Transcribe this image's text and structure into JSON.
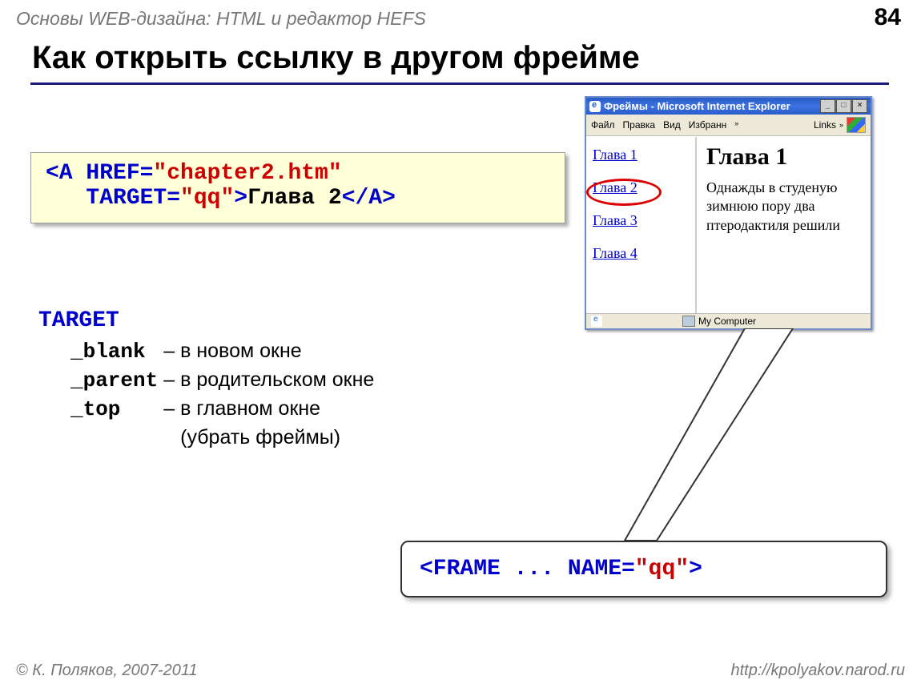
{
  "header": {
    "topic": "Основы WEB-дизайна: HTML и редактор HEFS",
    "page_number": "84"
  },
  "title": "Как открыть ссылку в другом фрейме",
  "code_example": {
    "l1_open": "<A HREF=",
    "l1_href": "\"chapter2.htm\"",
    "l2_indent_target": "TARGET=",
    "l2_qq": "\"qq\"",
    "l2_gt": ">",
    "l2_text": "Глава 2",
    "l2_close": "</A>"
  },
  "target": {
    "heading": "TARGET",
    "rows": [
      {
        "kw": "_blank",
        "dash": "–",
        "desc": "в новом окне"
      },
      {
        "kw": "_parent",
        "dash": "–",
        "desc": "в родительском окне"
      },
      {
        "kw": "_top",
        "dash": "–",
        "desc": "в главном окне"
      }
    ],
    "extra": "(убрать фреймы)"
  },
  "browser": {
    "title": "Фреймы - Microsoft Internet Explorer",
    "menu": [
      "Файл",
      "Правка",
      "Вид",
      "Избранн"
    ],
    "links_label": "Links",
    "chapters": [
      "Глава 1",
      "Глава 2",
      "Глава 3",
      "Глава 4"
    ],
    "content_heading": "Глава 1",
    "content_text": "Однажды в студеную зимнюю пору два птеродактиля решили",
    "status_right": "My Computer"
  },
  "callout": {
    "frame_open": "<FRAME ... ",
    "name_attr": "NAME=",
    "qq": "\"qq\"",
    "close": ">"
  },
  "footer": {
    "left": "© К. Поляков, 2007-2011",
    "right": "http://kpolyakov.narod.ru"
  }
}
